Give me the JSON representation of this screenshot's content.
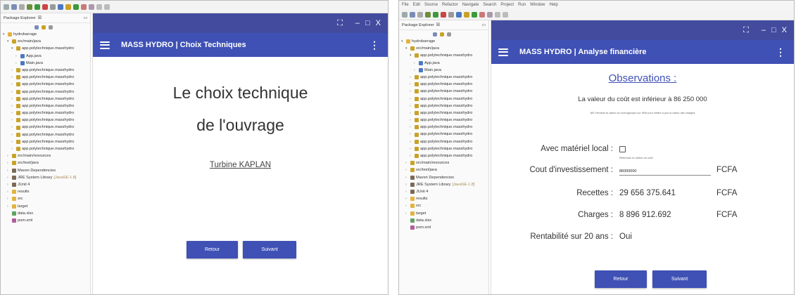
{
  "left": {
    "explorer": {
      "title": "Package Explorer",
      "title_suffix": "☒",
      "items": [
        {
          "label": "hydrobarrage",
          "indent": 0,
          "icon": "folder",
          "arrow": "▾"
        },
        {
          "label": "src/main/java",
          "indent": 1,
          "icon": "pkg",
          "arrow": "▾"
        },
        {
          "label": "app.polytechnique.masshydro",
          "indent": 2,
          "icon": "pkg",
          "arrow": "▾"
        },
        {
          "label": "App.java",
          "indent": 3,
          "icon": "java",
          "arrow": "›"
        },
        {
          "label": "Main.java",
          "indent": 3,
          "icon": "java",
          "arrow": "›"
        },
        {
          "label": "app.polytechnique.masshydro",
          "indent": 2,
          "icon": "pkg",
          "arrow": "›"
        },
        {
          "label": "app.polytechnique.masshydro",
          "indent": 2,
          "icon": "pkg",
          "arrow": "›"
        },
        {
          "label": "app.polytechnique.masshydro",
          "indent": 2,
          "icon": "pkg",
          "arrow": "›"
        },
        {
          "label": "app.polytechnique.masshydro",
          "indent": 2,
          "icon": "pkg",
          "arrow": "›"
        },
        {
          "label": "app.polytechnique.masshydro",
          "indent": 2,
          "icon": "pkg",
          "arrow": "›"
        },
        {
          "label": "app.polytechnique.masshydro",
          "indent": 2,
          "icon": "pkg",
          "arrow": "›"
        },
        {
          "label": "app.polytechnique.masshydro",
          "indent": 2,
          "icon": "pkg",
          "arrow": "›"
        },
        {
          "label": "app.polytechnique.masshydro",
          "indent": 2,
          "icon": "pkg",
          "arrow": "›"
        },
        {
          "label": "app.polytechnique.masshydro",
          "indent": 2,
          "icon": "pkg",
          "arrow": "›"
        },
        {
          "label": "app.polytechnique.masshydro",
          "indent": 2,
          "icon": "pkg",
          "arrow": "›"
        },
        {
          "label": "app.polytechnique.masshydro",
          "indent": 2,
          "icon": "pkg",
          "arrow": "›"
        },
        {
          "label": "app.polytechnique.masshydro",
          "indent": 2,
          "icon": "pkg",
          "arrow": "›"
        },
        {
          "label": "src/main/resources",
          "indent": 1,
          "icon": "pkg",
          "arrow": "›"
        },
        {
          "label": "src/test/java",
          "indent": 1,
          "icon": "pkg",
          "arrow": "›"
        },
        {
          "label": "Maven Dependencies",
          "indent": 1,
          "icon": "lib",
          "arrow": "›"
        },
        {
          "label": "JRE System Library",
          "indent": 1,
          "icon": "lib",
          "arrow": "›",
          "suffix": "[JavaSE-1.8]"
        },
        {
          "label": "JUnit 4",
          "indent": 1,
          "icon": "lib",
          "arrow": "›"
        },
        {
          "label": "results",
          "indent": 1,
          "icon": "folder",
          "arrow": "›"
        },
        {
          "label": "src",
          "indent": 1,
          "icon": "folder",
          "arrow": "›"
        },
        {
          "label": "target",
          "indent": 1,
          "icon": "folder",
          "arrow": "›"
        },
        {
          "label": "data.xlsx",
          "indent": 1,
          "icon": "file",
          "arrow": ""
        },
        {
          "label": "pom.xml",
          "indent": 1,
          "icon": "xml",
          "arrow": ""
        }
      ]
    },
    "emulator": {
      "window_controls": [
        "⛶",
        "–",
        "□",
        "X"
      ],
      "app_title": "MASS HYDRO | Choix Techniques",
      "heading_line1": "Le choix technique",
      "heading_line2": "de l'ouvrage",
      "choice": "Turbine KAPLAN",
      "back_button": "Retour",
      "next_button": "Suivant"
    }
  },
  "right": {
    "menu": [
      "File",
      "Edit",
      "Source",
      "Refactor",
      "Navigate",
      "Search",
      "Project",
      "Run",
      "Window",
      "Help"
    ],
    "explorer": {
      "title": "Package Explorer",
      "title_suffix": "☒"
    },
    "emulator": {
      "window_controls": [
        "⛶",
        "–",
        "□",
        "X"
      ],
      "app_title": "MASS HYDRO | Analyse financière",
      "obs_title": "Observations :",
      "obs_text": "La valeur du coût est inférieur à 86 250 000",
      "obs_note": "NB: Fendent la valeur du coût appuyez sur Shift pour mettre à jour la valeur des charges",
      "local_label": "Avec matériel local :",
      "local_hint": "Retenues la valeur du coût",
      "local_checked": false,
      "cost_label": "Cout d'investissement :",
      "cost_value": "86000000",
      "currency": "FCFA",
      "revenue_label": "Recettes :",
      "revenue_value": "29 656 375.641",
      "charges_label": "Charges :",
      "charges_value": "8 896 912.692",
      "profit_label": "Rentabilité sur 20 ans :",
      "profit_value": "Oui",
      "back_button": "Retour",
      "next_button": "Suivant"
    }
  },
  "colors": {
    "appbar": "#3f51b5",
    "titlebar": "#434b9e",
    "accent": "#3f51b5"
  }
}
